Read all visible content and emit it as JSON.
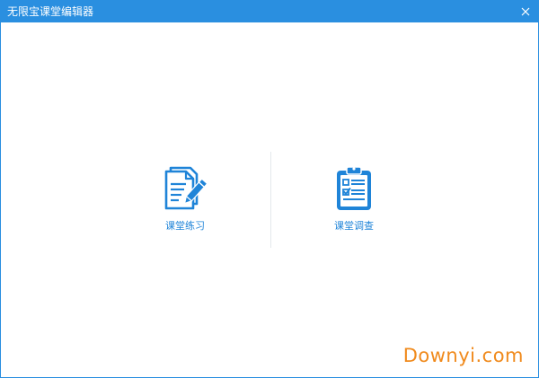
{
  "window": {
    "title": "无限宝课堂编辑器",
    "accent_color": "#2a8fe0",
    "close_icon": "close-icon"
  },
  "options": [
    {
      "label": "课堂练习",
      "icon": "document-pen-icon"
    },
    {
      "label": "课堂调查",
      "icon": "clipboard-checklist-icon"
    }
  ],
  "label_color": "#1f84d8",
  "watermark": {
    "text": "Downyi.com",
    "color": "#f08a1c"
  }
}
